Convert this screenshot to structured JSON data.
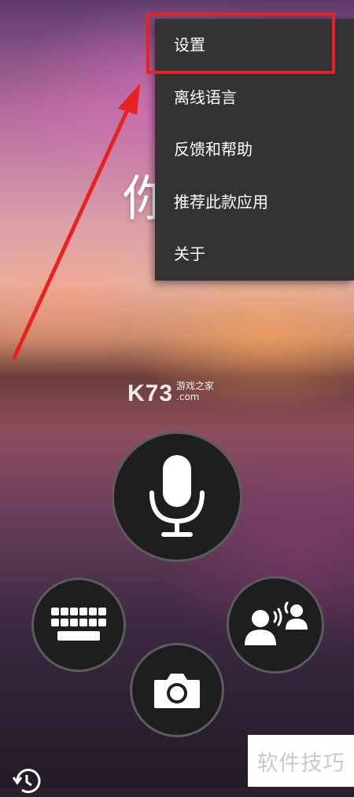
{
  "greeting": "你",
  "watermark": {
    "logo": "K73",
    "line1": "游戏之家",
    "line2": ".com"
  },
  "menu": {
    "items": [
      {
        "label": "设置"
      },
      {
        "label": "离线语言"
      },
      {
        "label": "反馈和帮助"
      },
      {
        "label": "推荐此款应用"
      },
      {
        "label": "关于"
      }
    ],
    "highlighted_index": 0
  },
  "buttons": {
    "microphone": "microphone-icon",
    "keyboard": "keyboard-icon",
    "camera": "camera-icon",
    "conversation": "conversation-icon",
    "history": "history-icon"
  },
  "brand_watermark": "软件技巧",
  "colors": {
    "highlight": "#e8231f",
    "menu_bg": "#333333",
    "button_bg": "#1e1e1e"
  }
}
